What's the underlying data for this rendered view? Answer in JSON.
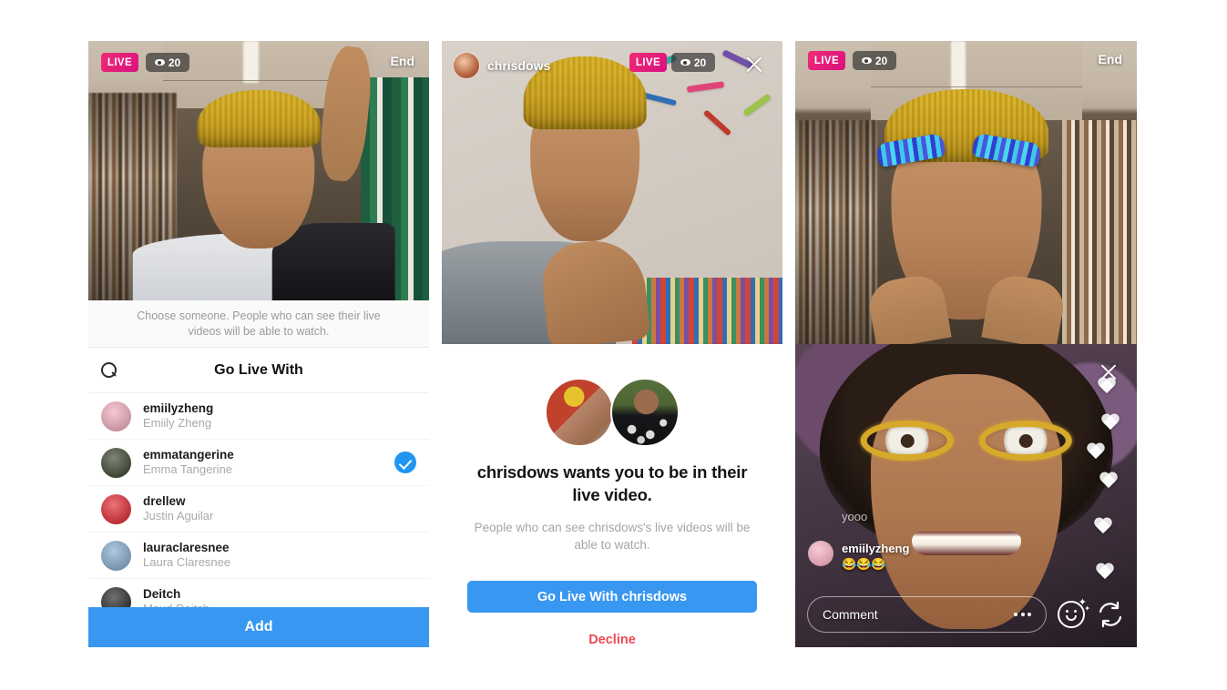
{
  "panel1": {
    "name": "go-live-with-picker",
    "live_badge": "LIVE",
    "viewer_count": "20",
    "end_label": "End",
    "hint": "Choose someone. People who can see their live videos will be able to watch.",
    "list_title": "Go Live With",
    "search_icon": "search-icon",
    "users": [
      {
        "username": "emiilyzheng",
        "fullname": "Emiily Zheng",
        "selected": false,
        "avatar_color": "#f2a8bb"
      },
      {
        "username": "emmatangerine",
        "fullname": "Emma Tangerine",
        "selected": true,
        "avatar_color": "#2f3a22"
      },
      {
        "username": "drellew",
        "fullname": "Justin Aguilar",
        "selected": false,
        "avatar_color": "#e01b24"
      },
      {
        "username": "lauraclaresnee",
        "fullname": "Laura Claresnee",
        "selected": false,
        "avatar_color": "#7fa6cc"
      },
      {
        "username": "Deitch",
        "fullname": "Maud Deitch",
        "selected": false,
        "avatar_color": "#1a1a1a"
      }
    ],
    "add_label": "Add"
  },
  "panel2": {
    "name": "live-invitation-dialog",
    "broadcaster": "chrisdows",
    "live_badge": "LIVE",
    "viewer_count": "20",
    "close_icon": "close-icon",
    "title": "chrisdows wants you to be in their live video.",
    "subtitle": "People who can see chrisdows's live videos will be able to watch.",
    "accept_label": "Go Live With chrisdows",
    "decline_label": "Decline"
  },
  "panel3": {
    "name": "live-split-broadcast",
    "live_badge": "LIVE",
    "viewer_count": "20",
    "end_label": "End",
    "close_icon": "close-icon",
    "comments": [
      {
        "username": "",
        "text": "",
        "faded": "true"
      },
      {
        "username": "",
        "text": "yooo",
        "faded": "half"
      },
      {
        "username": "emiilyzheng",
        "text": "😂😂😂",
        "faded": "false",
        "avatar_color": "#f5a7bd"
      }
    ],
    "comment_placeholder": "Comment",
    "more_icon": "more-options-icon",
    "effects_icon": "face-effects-icon",
    "flip_icon": "flip-camera-icon",
    "hearts_icon": "heart-icon"
  },
  "colors": {
    "instagram_blue": "#3897f0",
    "live_pink": "#ec2a74",
    "decline_red": "#ed4956",
    "muted_gray": "#a6a6a6"
  }
}
